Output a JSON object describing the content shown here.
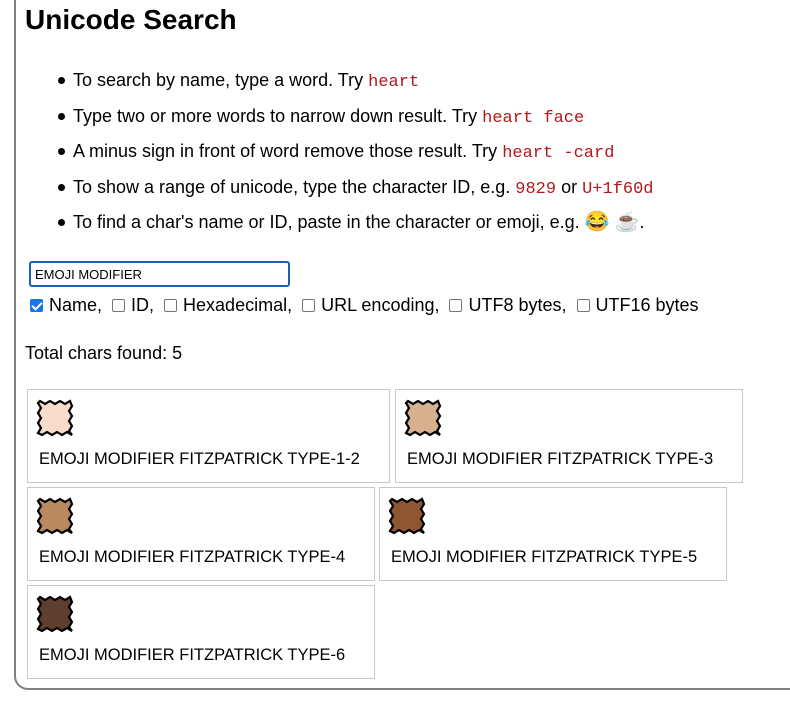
{
  "page": {
    "title": "Unicode Search"
  },
  "tips": [
    {
      "text": "To search by name, type a word. Try ",
      "code1": "heart"
    },
    {
      "text": "Type two or more words to narrow down result. Try ",
      "code1": "heart face"
    },
    {
      "text": "A minus sign in front of word remove those result. Try ",
      "code1": "heart -card"
    },
    {
      "text": "To show a range of unicode, type the character ID, e.g. ",
      "code1": "9829",
      "mid": " or ",
      "code2": "U+1f60d"
    },
    {
      "text": "To find a char's name or ID, paste in the character or emoji, e.g. ",
      "emoji1": "😂",
      "emoji2": "☕",
      "end": "."
    }
  ],
  "search": {
    "value": "EMOJI MODIFIER"
  },
  "options": [
    {
      "label": "Name,",
      "checked": true
    },
    {
      "label": "ID,",
      "checked": false
    },
    {
      "label": "Hexadecimal,",
      "checked": false
    },
    {
      "label": "URL encoding,",
      "checked": false
    },
    {
      "label": "UTF8 bytes,",
      "checked": false
    },
    {
      "label": "UTF16 bytes",
      "checked": false
    }
  ],
  "results": {
    "total_label": "Total chars found: 5",
    "items": [
      {
        "name": "EMOJI MODIFIER FITZPATRICK TYPE-1-2",
        "color": "#f9dcc9"
      },
      {
        "name": "EMOJI MODIFIER FITZPATRICK TYPE-3",
        "color": "#d7b08f"
      },
      {
        "name": "EMOJI MODIFIER FITZPATRICK TYPE-4",
        "color": "#b98a60"
      },
      {
        "name": "EMOJI MODIFIER FITZPATRICK TYPE-5",
        "color": "#8f5634"
      },
      {
        "name": "EMOJI MODIFIER FITZPATRICK TYPE-6",
        "color": "#5e3f2f"
      }
    ]
  }
}
